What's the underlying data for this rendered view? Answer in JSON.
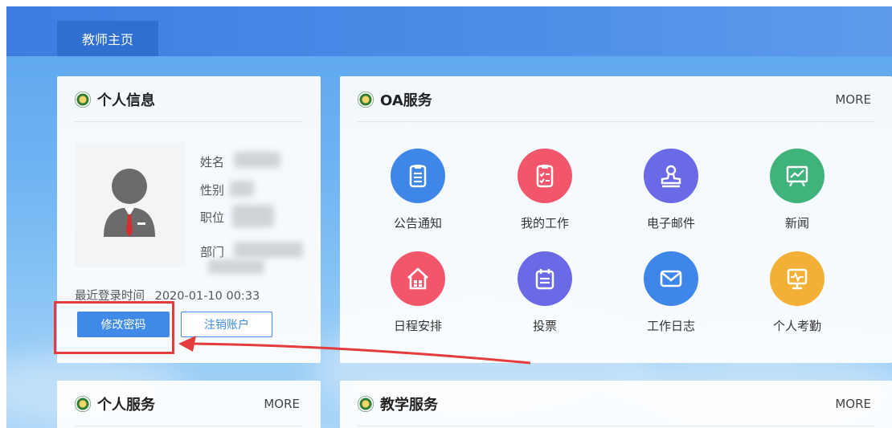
{
  "header": {
    "tab_home": "教师主页"
  },
  "personal_info": {
    "title": "个人信息",
    "fields": {
      "name_label": "姓名",
      "gender_label": "性别",
      "position_label": "职位",
      "department_label": "部门"
    },
    "last_login_label": "最近登录时间",
    "last_login_value": "2020-01-10 00:33",
    "change_password_button": "修改密码",
    "logout_account_button": "注销账户"
  },
  "oa_services": {
    "title": "OA服务",
    "more": "MORE",
    "items": [
      {
        "label": "公告通知",
        "icon": "clipboard-icon",
        "color": "#3e86e8"
      },
      {
        "label": "我的工作",
        "icon": "task-list-icon",
        "color": "#f2566a"
      },
      {
        "label": "电子邮件",
        "icon": "stamp-icon",
        "color": "#6b6ae6"
      },
      {
        "label": "新闻",
        "icon": "presentation-chart-icon",
        "color": "#3fb37b"
      },
      {
        "label": "日程安排",
        "icon": "house-icon",
        "color": "#f2566a"
      },
      {
        "label": "投票",
        "icon": "calendar-icon",
        "color": "#6b6ae6"
      },
      {
        "label": "工作日志",
        "icon": "mail-icon",
        "color": "#3e86e8"
      },
      {
        "label": "个人考勤",
        "icon": "monitor-pulse-icon",
        "color": "#f2b136"
      }
    ]
  },
  "personal_services": {
    "title": "个人服务",
    "more": "MORE"
  },
  "teaching_services": {
    "title": "教学服务",
    "more": "MORE"
  },
  "colors": {
    "accent": "#3e8ae6",
    "topbar": "#3b7ee0",
    "annotation": "#e43c3c"
  }
}
